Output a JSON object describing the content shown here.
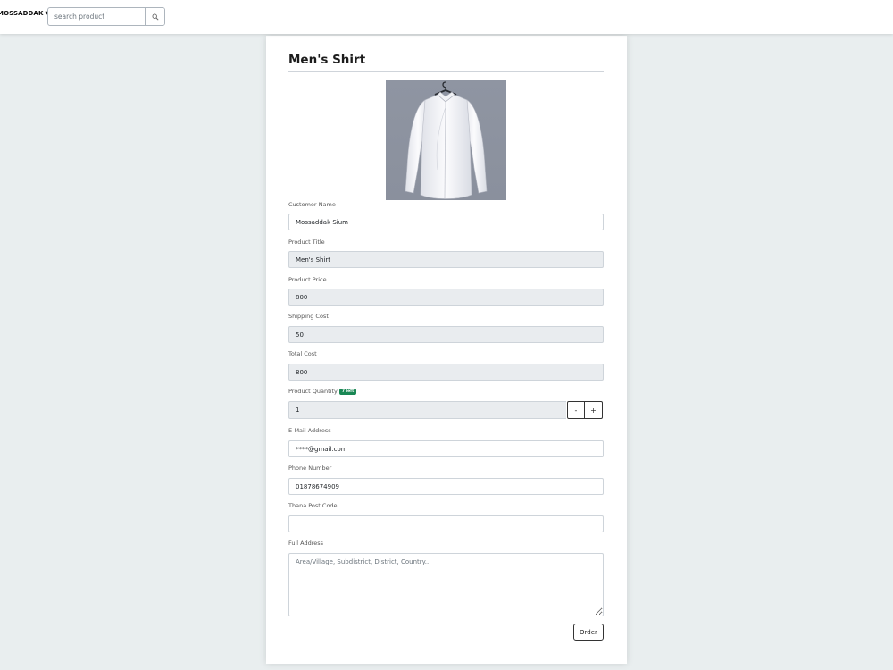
{
  "navbar": {
    "user_name": "MOSSADDAK",
    "search": {
      "placeholder": "search product",
      "value": ""
    },
    "search_icon": "search-icon"
  },
  "product": {
    "heading": "Men's Shirt",
    "image_icon": "shirt-image"
  },
  "form": {
    "customer_name": {
      "label": "Customer Name",
      "value": "Mossaddak Sium"
    },
    "product_title": {
      "label": "Product Title",
      "value": "Men's Shirt"
    },
    "product_price": {
      "label": "Product Price",
      "value": "800"
    },
    "shipping_cost": {
      "label": "Shipping Cost",
      "value": "50"
    },
    "total_cost": {
      "label": "Total Cost",
      "value": "800"
    },
    "quantity": {
      "label": "Product Quantity",
      "stock_badge": "7 left",
      "value": "1",
      "minus_label": "-",
      "plus_label": "+"
    },
    "email": {
      "label": "E-Mail Address",
      "value": "****@gmail.com"
    },
    "phone": {
      "label": "Phone Number",
      "value": "01878674909"
    },
    "post_code": {
      "label": "Thana Post Code",
      "value": ""
    },
    "address": {
      "label": "Full Address",
      "value": "",
      "placeholder": "Area/Village, Subdistrict, District, Country..."
    },
    "submit_label": "Order"
  },
  "colors": {
    "page_bg": "#e9eeef",
    "readonly_bg": "#e9ecef",
    "badge_green": "#198754"
  }
}
